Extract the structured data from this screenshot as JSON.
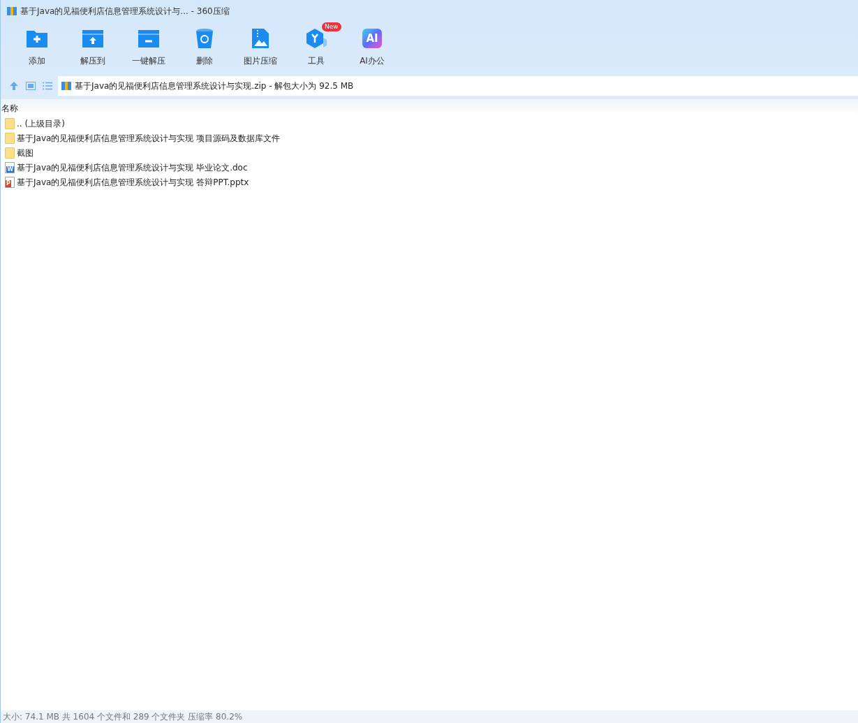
{
  "window": {
    "title": "基于Java的见福便利店信息管理系统设计与... - 360压缩"
  },
  "toolbar": [
    {
      "label": "添加",
      "kind": "add"
    },
    {
      "label": "解压到",
      "kind": "extract"
    },
    {
      "label": "一键解压",
      "kind": "oneclick"
    },
    {
      "label": "删除",
      "kind": "delete"
    },
    {
      "label": "图片压缩",
      "kind": "image"
    },
    {
      "label": "工具",
      "kind": "tools",
      "badge": "New"
    },
    {
      "label": "AI办公",
      "kind": "ai",
      "icon_text": "AI"
    }
  ],
  "address_bar": {
    "path": "基于Java的见福便利店信息管理系统设计与实现.zip - 解包大小为 92.5 MB"
  },
  "table": {
    "columns": [
      "名称"
    ],
    "rows": [
      {
        "name": ".. (上级目录)",
        "kind": "folder"
      },
      {
        "name": "基于Java的见福便利店信息管理系统设计与实现 项目源码及数据库文件",
        "kind": "folder"
      },
      {
        "name": "截图",
        "kind": "folder"
      },
      {
        "name": "基于Java的见福便利店信息管理系统设计与实现 毕业论文.doc",
        "kind": "word",
        "icon_text": "W"
      },
      {
        "name": "基于Java的见福便利店信息管理系统设计与实现 答辩PPT.pptx",
        "kind": "ppt",
        "icon_text": "P"
      }
    ]
  },
  "status_bar": "大小: 74.1 MB 共 1604 个文件和 289 个文件夹 压缩率 80.2%"
}
